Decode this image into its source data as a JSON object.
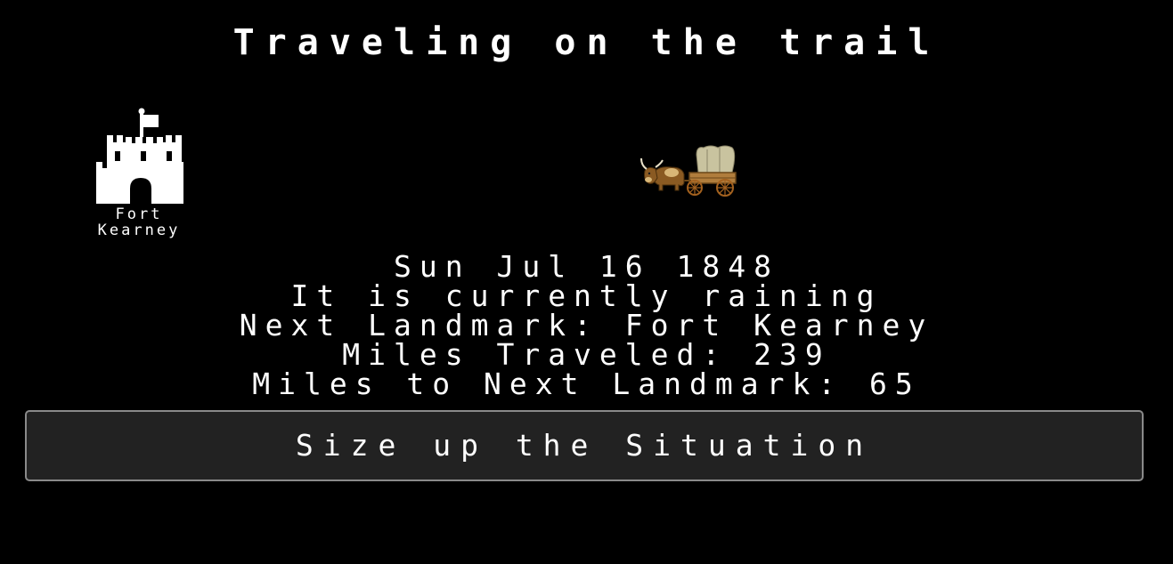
{
  "screen": {
    "title": "Traveling on the trail"
  },
  "landmark": {
    "icon": "castle-icon",
    "label_line1": "Fort",
    "label_line2": "Kearney"
  },
  "wagon": {
    "icon": "ox-wagon-icon"
  },
  "status": {
    "date": "Sun Jul 16 1848",
    "weather": "It is currently raining",
    "next_landmark": "Next Landmark: Fort Kearney",
    "miles_traveled": "Miles Traveled: 239",
    "miles_to_next": "Miles to Next Landmark: 65"
  },
  "actions": {
    "primary_label": "Size up the Situation"
  },
  "colors": {
    "background": "#000000",
    "text": "#ffffff",
    "button_background": "#222222",
    "button_border": "#8a8a8a"
  }
}
